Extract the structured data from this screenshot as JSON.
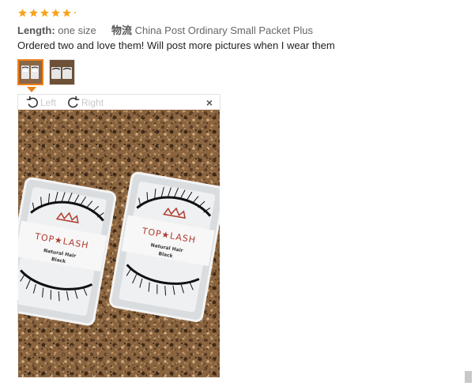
{
  "review": {
    "rating_stars": 5,
    "length_key": "Length:",
    "length_value": "one size",
    "shipping_key": "物流",
    "shipping_value": "China Post Ordinary Small Packet Plus",
    "text": "Ordered two and love them! Will post more pictures when I wear them"
  },
  "photo_viewer": {
    "rotate_left_label": "Left",
    "rotate_right_label": "Right",
    "close_label": "×",
    "thumbnail_count": 2,
    "active_thumbnail": 1
  },
  "product_box": {
    "brand": "TOP★LASH",
    "line1": "Natural Hair",
    "line2": "Black"
  },
  "colors": {
    "star": "#f7a41d",
    "active_border": "#ef7f1a"
  }
}
